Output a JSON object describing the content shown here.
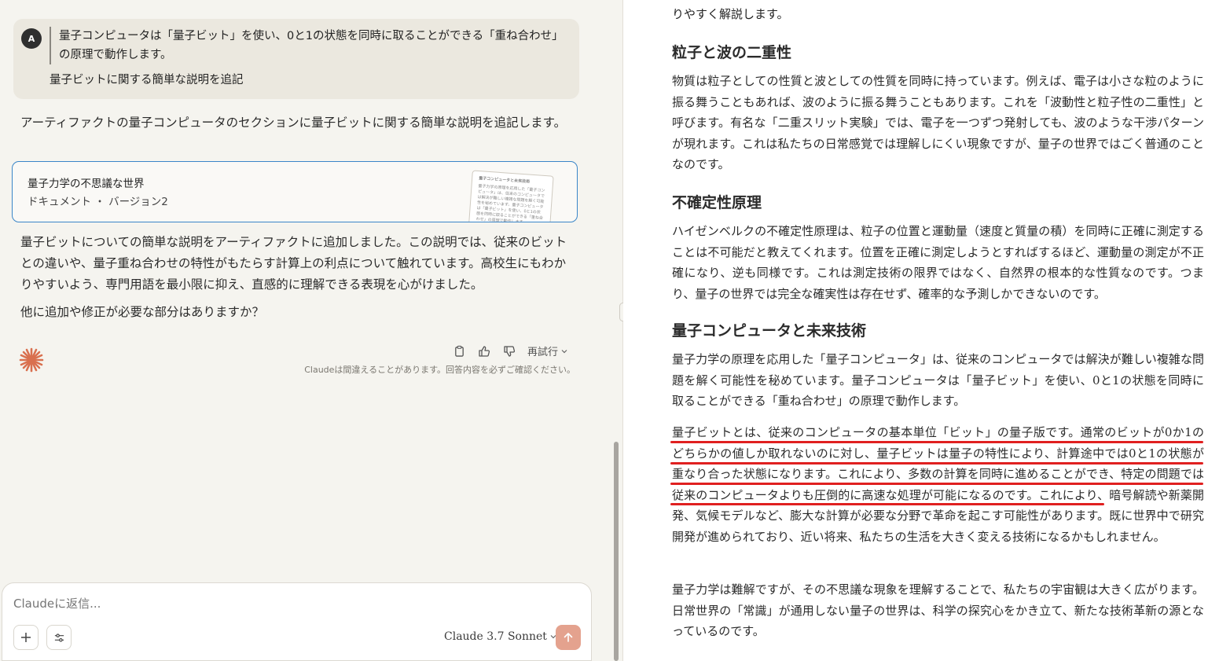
{
  "user_message": {
    "avatar": "A",
    "quote": "量子コンピュータは「量子ビット」を使い、0と1の状態を同時に取ることができる「重ね合わせ」の原理で動作します。",
    "text": "量子ビットに関する簡単な説明を追記"
  },
  "assistant": {
    "intro": "アーティファクトの量子コンピュータのセクションに量子ビットに関する簡単な説明を追記します。",
    "artifact": {
      "title": "量子力学の不思議な世界",
      "subtitle": "ドキュメント ・ バージョン2",
      "thumb_heading": "量子コンピュータと未来技術",
      "thumb_text": "量子力学の原理を応用した「量子コンピュータ」は、従来のコンピュータでは解決が難しい複雑な問題を解く可能性を秘めています。量子コンピュータは「量子ビット」を使い、0と1の状態を同時に取ることができる「重ね合わせ」の原理で動作します。"
    },
    "body": "量子ビットについての簡単な説明をアーティファクトに追加しました。この説明では、従来のビットとの違いや、量子重ね合わせの特性がもたらす計算上の利点について触れています。高校生にもわかりやすいよう、専門用語を最小限に抑え、直感的に理解できる表現を心がけました。",
    "question": "他に追加や修正が必要な部分はありますか？",
    "retry_label": "再試行",
    "disclaimer": "Claudeは間違えることがあります。回答内容を必ずご確認ください。"
  },
  "composer": {
    "placeholder": "Claudeに返信...",
    "model": "Claude 3.7 Sonnet"
  },
  "document": {
    "top_fragment": "りやすく解説します。",
    "sections": [
      {
        "heading": "粒子と波の二重性",
        "paragraphs": [
          "物質は粒子としての性質と波としての性質を同時に持っています。例えば、電子は小さな粒のように振る舞うこともあれば、波のように振る舞うこともあります。これを「波動性と粒子性の二重性」と呼びます。有名な「二重スリット実験」では、電子を一つずつ発射しても、波のような干渉パターンが現れます。これは私たちの日常感覚では理解しにくい現象ですが、量子の世界ではごく普通のことなのです。"
        ]
      },
      {
        "heading": "不確定性原理",
        "paragraphs": [
          "ハイゼンベルクの不確定性原理は、粒子の位置と運動量（速度と質量の積）を同時に正確に測定することは不可能だと教えてくれます。位置を正確に測定しようとすればするほど、運動量の測定が不正確になり、逆も同様です。これは測定技術の限界ではなく、自然界の根本的な性質なのです。つまり、量子の世界では完全な確実性は存在せず、確率的な予測しかできないのです。"
        ]
      },
      {
        "heading": "量子コンピュータと未来技術",
        "paragraphs": [
          "量子力学の原理を応用した「量子コンピュータ」は、従来のコンピュータでは解決が難しい複雑な問題を解く可能性を秘めています。量子コンピュータは「量子ビット」を使い、0と1の状態を同時に取ることができる「重ね合わせ」の原理で動作します。",
          "量子ビットとは、従来のコンピュータの基本単位「ビット」の量子版です。通常のビットが0か1のどちらかの値しか取れないのに対し、量子ビットは量子の特性により、計算途中では0と1の状態が重なり合った状態になります。これにより、多数の計算を同時に進めることができ、特定の問題では従来のコンピュータよりも圧倒的に高速な処理が可能になるのです。これにより、暗号解読や新薬開発、気候モデルなど、膨大な計算が必要な分野で革命を起こす可能性があります。既に世界中で研究開発が進められており、近い将来、私たちの生活を大きく変える技術になるかもしれません。",
          "量子力学は難解ですが、その不思議な現象を理解することで、私たちの宇宙観は大きく広がります。日常世界の「常識」が通用しない量子の世界は、科学の探究心をかき立て、新たな技術革新の源となっているのです。"
        ]
      }
    ]
  },
  "colors": {
    "accent_border": "#3a86c8",
    "send_button": "#e4a28e",
    "annotation_red": "#e02020",
    "claude_orange": "#d9704f"
  }
}
